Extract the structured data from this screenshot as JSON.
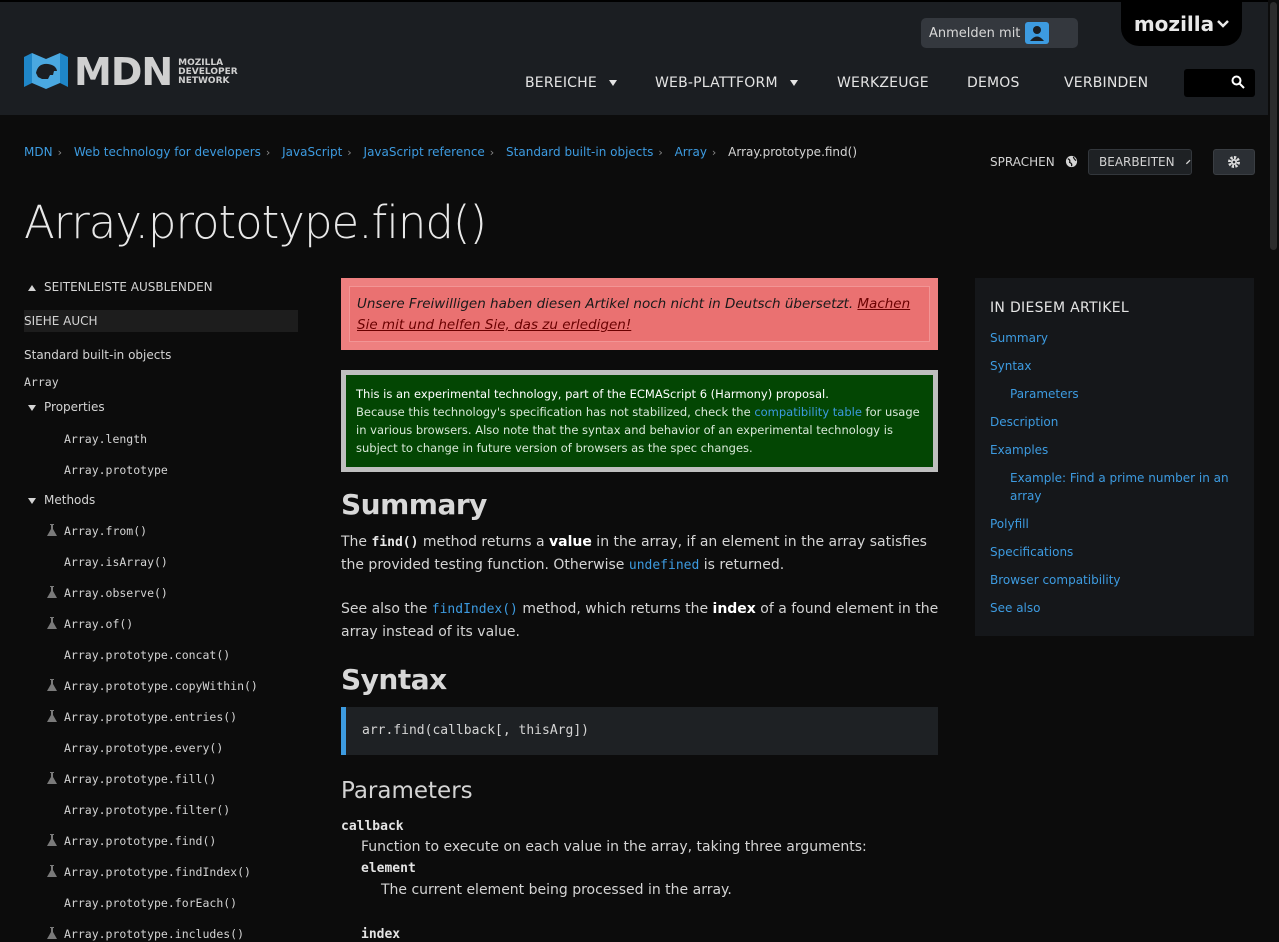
{
  "header": {
    "logo_text": "MDN",
    "logo_sub": [
      "MOZILLA",
      "DEVELOPER",
      "NETWORK"
    ],
    "signin_label": "Anmelden mit",
    "mozilla_label": "mozilla",
    "nav": [
      {
        "label": "BEREICHE",
        "dropdown": true
      },
      {
        "label": "WEB-PLATTFORM",
        "dropdown": true
      },
      {
        "label": "WERKZEUGE",
        "dropdown": false
      },
      {
        "label": "DEMOS",
        "dropdown": false
      },
      {
        "label": "VERBINDEN",
        "dropdown": false
      }
    ]
  },
  "breadcrumb": {
    "links": [
      "MDN",
      "Web technology for developers",
      "JavaScript",
      "JavaScript reference",
      "Standard built-in objects",
      "Array"
    ],
    "current": "Array.prototype.find()"
  },
  "tools": {
    "languages_label": "SPRACHEN",
    "edit_label": "BEARBEITEN"
  },
  "page_title": "Array.prototype.find()",
  "sidebar": {
    "toggle_label": "SEITENLEISTE AUSBLENDEN",
    "see_also": "SIEHE AUCH",
    "standard_objects": "Standard built-in objects",
    "array": "Array",
    "properties_label": "Properties",
    "properties": [
      "Array.length",
      "Array.prototype"
    ],
    "methods_label": "Methods",
    "methods": [
      {
        "name": "Array.from()",
        "experimental": true
      },
      {
        "name": "Array.isArray()",
        "experimental": false
      },
      {
        "name": "Array.observe()",
        "experimental": true
      },
      {
        "name": "Array.of()",
        "experimental": true
      },
      {
        "name": "Array.prototype.concat()",
        "experimental": false
      },
      {
        "name": "Array.prototype.copyWithin()",
        "experimental": true
      },
      {
        "name": "Array.prototype.entries()",
        "experimental": true
      },
      {
        "name": "Array.prototype.every()",
        "experimental": false
      },
      {
        "name": "Array.prototype.fill()",
        "experimental": true
      },
      {
        "name": "Array.prototype.filter()",
        "experimental": false
      },
      {
        "name": "Array.prototype.find()",
        "experimental": true
      },
      {
        "name": "Array.prototype.findIndex()",
        "experimental": true
      },
      {
        "name": "Array.prototype.forEach()",
        "experimental": false
      },
      {
        "name": "Array.prototype.includes()",
        "experimental": true
      }
    ]
  },
  "notice_red": {
    "text": "Unsere Freiwilligen haben diesen Artikel noch nicht in Deutsch übersetzt. ",
    "link": "Machen Sie mit und helfen Sie, das zu erledigen!"
  },
  "notice_green": {
    "first": "This is an experimental technology, part of the ECMAScript 6 (Harmony) proposal.",
    "second_pre": "Because this technology's specification has not stabilized, check the ",
    "second_link": "compatibility table",
    "second_post": " for usage in various browsers. Also note that the syntax and behavior of an experimental technology is subject to change in future version of browsers as the spec changes."
  },
  "summary": {
    "heading": "Summary",
    "p1": {
      "t1": "The ",
      "c1": "find()",
      "t2": " method returns a ",
      "b1": "value",
      "t3": " in the array, if an element in the array satisfies the provided testing function. Otherwise ",
      "c2": "undefined",
      "t4": " is returned."
    },
    "p2": {
      "t1": "See also the ",
      "c1": "findIndex()",
      "t2": " method, which returns the ",
      "b1": "index",
      "t3": " of a found element in the array instead of its value."
    }
  },
  "syntax": {
    "heading": "Syntax",
    "code": "arr.find(callback[, thisArg])"
  },
  "parameters": {
    "heading": "Parameters",
    "callback": "callback",
    "callback_desc": "Function to execute on each value in the array, taking three arguments:",
    "element": "element",
    "element_desc": "The current element being processed in the array.",
    "index": "index"
  },
  "toc": {
    "heading": "IN DIESEM ARTIKEL",
    "items": [
      {
        "label": "Summary",
        "indent": false
      },
      {
        "label": "Syntax",
        "indent": false
      },
      {
        "label": "Parameters",
        "indent": true
      },
      {
        "label": "Description",
        "indent": false
      },
      {
        "label": "Examples",
        "indent": false
      },
      {
        "label": "Example: Find a prime number in an",
        "label2": "array",
        "indent": true
      },
      {
        "label": "Polyfill",
        "indent": false
      },
      {
        "label": "Specifications",
        "indent": false
      },
      {
        "label": "Browser compatibility",
        "indent": false
      },
      {
        "label": "See also",
        "indent": false
      }
    ]
  },
  "colors": {
    "accent": "#3d9be0",
    "header_bg": "#1b1e22",
    "page_bg": "#0c0c0c",
    "notice_red": "#ea7171",
    "notice_green": "#034603"
  }
}
